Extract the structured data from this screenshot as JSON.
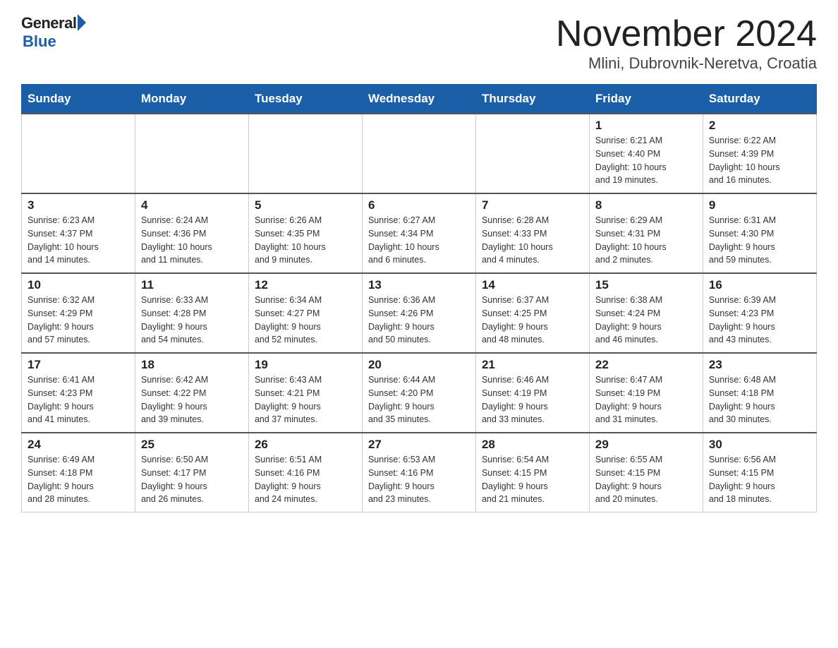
{
  "logo": {
    "general": "General",
    "blue": "Blue"
  },
  "title": {
    "month": "November 2024",
    "location": "Mlini, Dubrovnik-Neretva, Croatia"
  },
  "weekdays": [
    "Sunday",
    "Monday",
    "Tuesday",
    "Wednesday",
    "Thursday",
    "Friday",
    "Saturday"
  ],
  "weeks": [
    [
      {
        "day": "",
        "info": ""
      },
      {
        "day": "",
        "info": ""
      },
      {
        "day": "",
        "info": ""
      },
      {
        "day": "",
        "info": ""
      },
      {
        "day": "",
        "info": ""
      },
      {
        "day": "1",
        "info": "Sunrise: 6:21 AM\nSunset: 4:40 PM\nDaylight: 10 hours\nand 19 minutes."
      },
      {
        "day": "2",
        "info": "Sunrise: 6:22 AM\nSunset: 4:39 PM\nDaylight: 10 hours\nand 16 minutes."
      }
    ],
    [
      {
        "day": "3",
        "info": "Sunrise: 6:23 AM\nSunset: 4:37 PM\nDaylight: 10 hours\nand 14 minutes."
      },
      {
        "day": "4",
        "info": "Sunrise: 6:24 AM\nSunset: 4:36 PM\nDaylight: 10 hours\nand 11 minutes."
      },
      {
        "day": "5",
        "info": "Sunrise: 6:26 AM\nSunset: 4:35 PM\nDaylight: 10 hours\nand 9 minutes."
      },
      {
        "day": "6",
        "info": "Sunrise: 6:27 AM\nSunset: 4:34 PM\nDaylight: 10 hours\nand 6 minutes."
      },
      {
        "day": "7",
        "info": "Sunrise: 6:28 AM\nSunset: 4:33 PM\nDaylight: 10 hours\nand 4 minutes."
      },
      {
        "day": "8",
        "info": "Sunrise: 6:29 AM\nSunset: 4:31 PM\nDaylight: 10 hours\nand 2 minutes."
      },
      {
        "day": "9",
        "info": "Sunrise: 6:31 AM\nSunset: 4:30 PM\nDaylight: 9 hours\nand 59 minutes."
      }
    ],
    [
      {
        "day": "10",
        "info": "Sunrise: 6:32 AM\nSunset: 4:29 PM\nDaylight: 9 hours\nand 57 minutes."
      },
      {
        "day": "11",
        "info": "Sunrise: 6:33 AM\nSunset: 4:28 PM\nDaylight: 9 hours\nand 54 minutes."
      },
      {
        "day": "12",
        "info": "Sunrise: 6:34 AM\nSunset: 4:27 PM\nDaylight: 9 hours\nand 52 minutes."
      },
      {
        "day": "13",
        "info": "Sunrise: 6:36 AM\nSunset: 4:26 PM\nDaylight: 9 hours\nand 50 minutes."
      },
      {
        "day": "14",
        "info": "Sunrise: 6:37 AM\nSunset: 4:25 PM\nDaylight: 9 hours\nand 48 minutes."
      },
      {
        "day": "15",
        "info": "Sunrise: 6:38 AM\nSunset: 4:24 PM\nDaylight: 9 hours\nand 46 minutes."
      },
      {
        "day": "16",
        "info": "Sunrise: 6:39 AM\nSunset: 4:23 PM\nDaylight: 9 hours\nand 43 minutes."
      }
    ],
    [
      {
        "day": "17",
        "info": "Sunrise: 6:41 AM\nSunset: 4:23 PM\nDaylight: 9 hours\nand 41 minutes."
      },
      {
        "day": "18",
        "info": "Sunrise: 6:42 AM\nSunset: 4:22 PM\nDaylight: 9 hours\nand 39 minutes."
      },
      {
        "day": "19",
        "info": "Sunrise: 6:43 AM\nSunset: 4:21 PM\nDaylight: 9 hours\nand 37 minutes."
      },
      {
        "day": "20",
        "info": "Sunrise: 6:44 AM\nSunset: 4:20 PM\nDaylight: 9 hours\nand 35 minutes."
      },
      {
        "day": "21",
        "info": "Sunrise: 6:46 AM\nSunset: 4:19 PM\nDaylight: 9 hours\nand 33 minutes."
      },
      {
        "day": "22",
        "info": "Sunrise: 6:47 AM\nSunset: 4:19 PM\nDaylight: 9 hours\nand 31 minutes."
      },
      {
        "day": "23",
        "info": "Sunrise: 6:48 AM\nSunset: 4:18 PM\nDaylight: 9 hours\nand 30 minutes."
      }
    ],
    [
      {
        "day": "24",
        "info": "Sunrise: 6:49 AM\nSunset: 4:18 PM\nDaylight: 9 hours\nand 28 minutes."
      },
      {
        "day": "25",
        "info": "Sunrise: 6:50 AM\nSunset: 4:17 PM\nDaylight: 9 hours\nand 26 minutes."
      },
      {
        "day": "26",
        "info": "Sunrise: 6:51 AM\nSunset: 4:16 PM\nDaylight: 9 hours\nand 24 minutes."
      },
      {
        "day": "27",
        "info": "Sunrise: 6:53 AM\nSunset: 4:16 PM\nDaylight: 9 hours\nand 23 minutes."
      },
      {
        "day": "28",
        "info": "Sunrise: 6:54 AM\nSunset: 4:15 PM\nDaylight: 9 hours\nand 21 minutes."
      },
      {
        "day": "29",
        "info": "Sunrise: 6:55 AM\nSunset: 4:15 PM\nDaylight: 9 hours\nand 20 minutes."
      },
      {
        "day": "30",
        "info": "Sunrise: 6:56 AM\nSunset: 4:15 PM\nDaylight: 9 hours\nand 18 minutes."
      }
    ]
  ]
}
